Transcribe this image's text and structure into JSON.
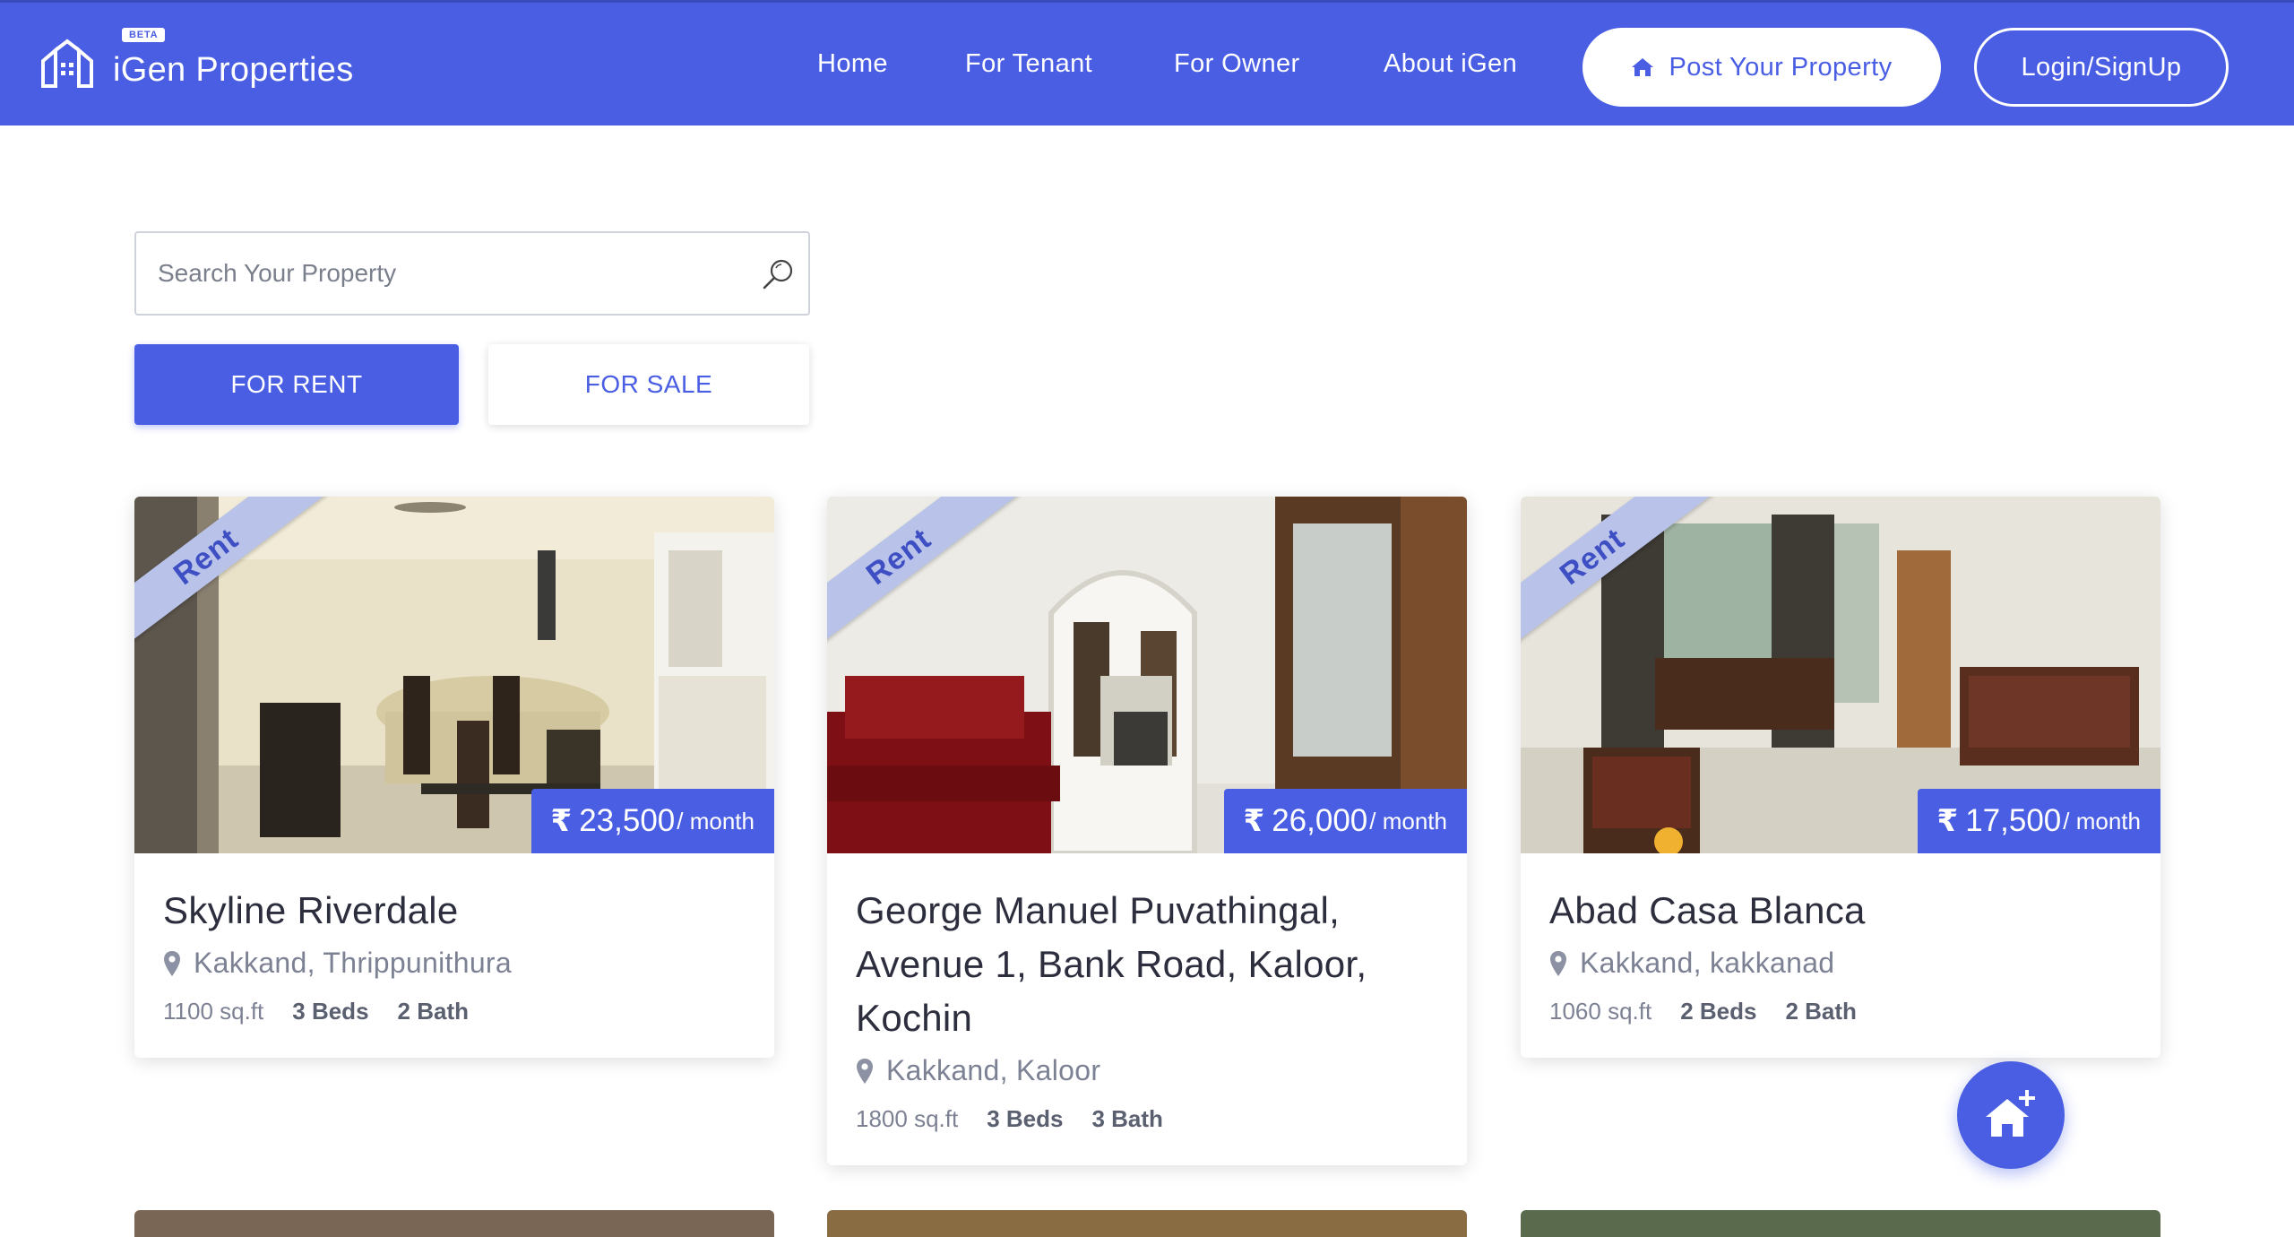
{
  "brand": {
    "name": "iGen Properties",
    "beta": "BETA"
  },
  "nav": {
    "home": "Home",
    "tenant": "For Tenant",
    "owner": "For Owner",
    "about": "About iGen",
    "post": "Post Your Property",
    "login": "Login/SignUp"
  },
  "search": {
    "placeholder": "Search Your Property"
  },
  "filters": {
    "rent": "FOR RENT",
    "sale": "FOR SALE"
  },
  "colors": {
    "primary": "#4a5ee4",
    "ribbon": "#b9c3ea"
  },
  "listings": [
    {
      "badge": "Rent",
      "currency": "₹",
      "price": "23,500",
      "period": "/ month",
      "title": "Skyline Riverdale",
      "location": "Kakkand, Thrippunithura",
      "area": "1100 sq.ft",
      "beds": "3 Beds",
      "baths": "2 Bath"
    },
    {
      "badge": "Rent",
      "currency": "₹",
      "price": "26,000",
      "period": "/ month",
      "title": "George Manuel Puvathingal, Avenue 1, Bank Road, Kaloor, Kochin",
      "location": "Kakkand, Kaloor",
      "area": "1800 sq.ft",
      "beds": "3 Beds",
      "baths": "3 Bath"
    },
    {
      "badge": "Rent",
      "currency": "₹",
      "price": "17,500",
      "period": "/ month",
      "title": "Abad Casa Blanca",
      "location": "Kakkand, kakkanad",
      "area": "1060 sq.ft",
      "beds": "2 Beds",
      "baths": "2 Bath"
    }
  ],
  "fab": {
    "icon": "add-home-icon"
  }
}
